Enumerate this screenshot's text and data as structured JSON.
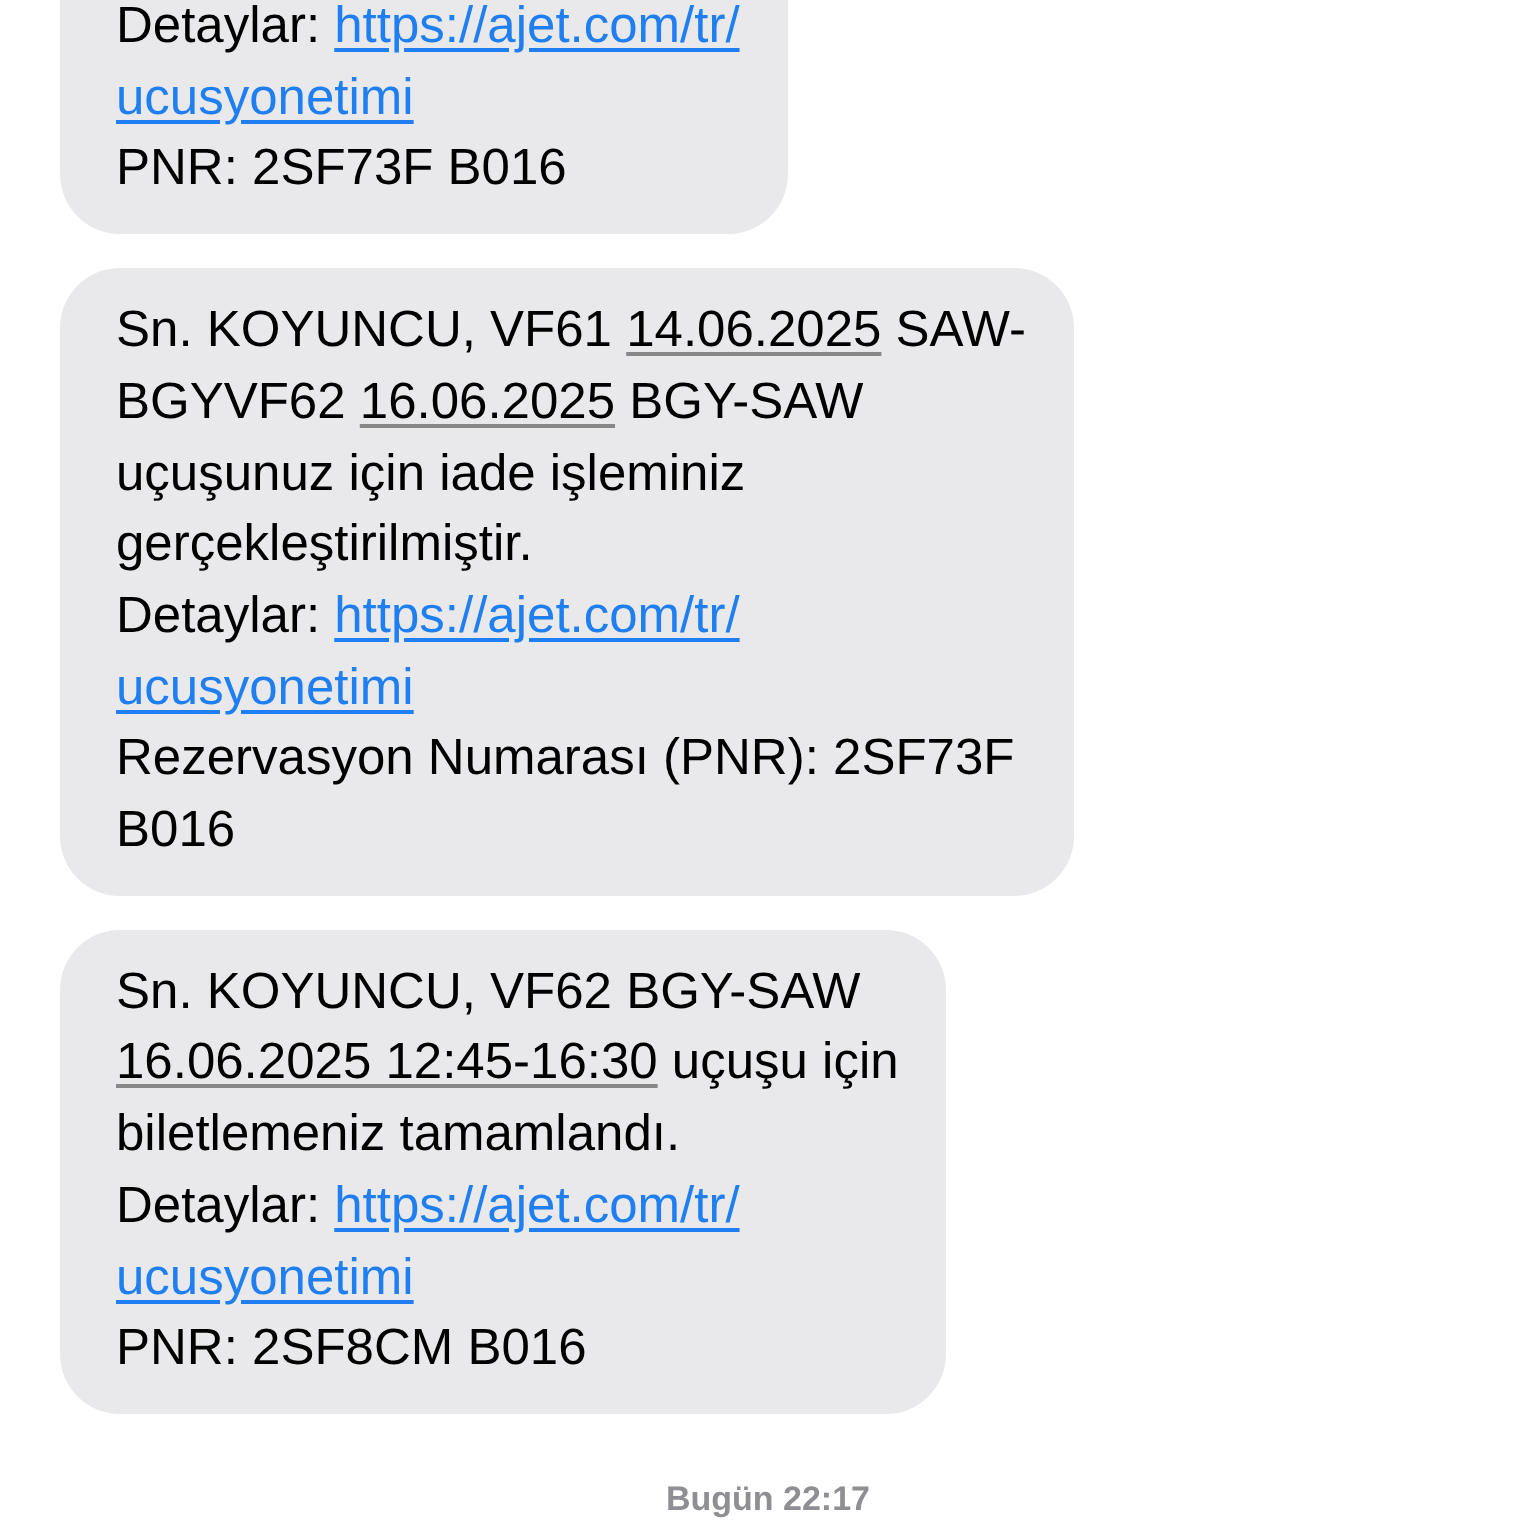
{
  "messages": [
    {
      "lines": [
        [
          {
            "kind": "text",
            "text": "Detaylar: "
          },
          {
            "kind": "link",
            "text": "https://ajet.com/tr/"
          }
        ],
        [
          {
            "kind": "link",
            "text": "ucusyonetimi"
          }
        ],
        [
          {
            "kind": "text",
            "text": "PNR: 2SF73F B016"
          }
        ]
      ]
    },
    {
      "lines": [
        [
          {
            "kind": "text",
            "text": "Sn. KOYUNCU, VF61 "
          },
          {
            "kind": "date",
            "text": "14.06.2025"
          },
          {
            "kind": "text",
            "text": " SAW-"
          }
        ],
        [
          {
            "kind": "text",
            "text": "BGYVF62 "
          },
          {
            "kind": "date",
            "text": "16.06.2025"
          },
          {
            "kind": "text",
            "text": " BGY-SAW"
          }
        ],
        [
          {
            "kind": "text",
            "text": "uçuşunuz için iade işleminiz"
          }
        ],
        [
          {
            "kind": "text",
            "text": "gerçekleştirilmiştir."
          }
        ],
        [
          {
            "kind": "text",
            "text": "Detaylar: "
          },
          {
            "kind": "link",
            "text": "https://ajet.com/tr/"
          }
        ],
        [
          {
            "kind": "link",
            "text": "ucusyonetimi"
          }
        ],
        [
          {
            "kind": "text",
            "text": "Rezervasyon Numarası (PNR): 2SF73F"
          }
        ],
        [
          {
            "kind": "text",
            "text": "B016"
          }
        ]
      ]
    },
    {
      "lines": [
        [
          {
            "kind": "text",
            "text": "Sn. KOYUNCU, VF62 BGY-SAW"
          }
        ],
        [
          {
            "kind": "date",
            "text": "16.06.2025 12:45-16:30"
          },
          {
            "kind": "text",
            "text": " uçuşu için"
          }
        ],
        [
          {
            "kind": "text",
            "text": "biletlemeniz tamamlandı."
          }
        ],
        [
          {
            "kind": "text",
            "text": "Detaylar: "
          },
          {
            "kind": "link",
            "text": "https://ajet.com/tr/"
          }
        ],
        [
          {
            "kind": "link",
            "text": "ucusyonetimi"
          }
        ],
        [
          {
            "kind": "text",
            "text": "PNR: 2SF8CM B016"
          }
        ]
      ]
    }
  ],
  "timestamp": "Bugün 22:17"
}
